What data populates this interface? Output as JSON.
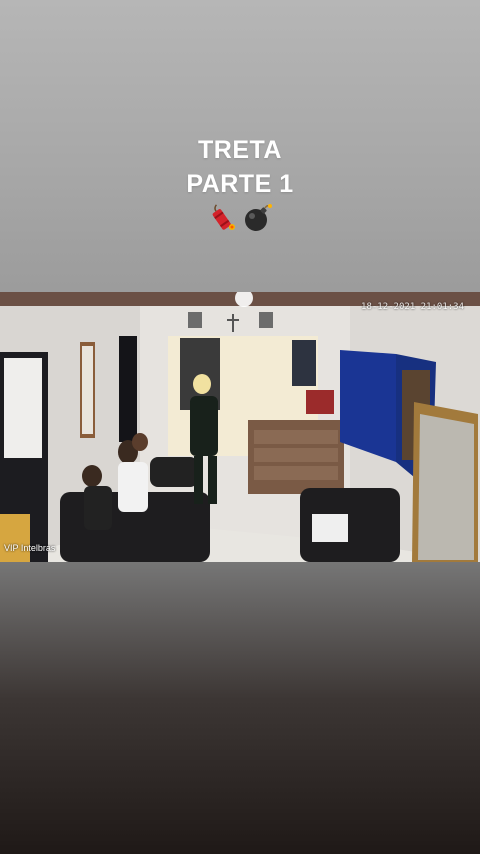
{
  "story": {
    "title_line1": "TRETA",
    "title_line2": "PARTE 1",
    "emojis": [
      "firecracker-icon",
      "bomb-icon"
    ]
  },
  "camera": {
    "timestamp": "18-12-2021 21:01:34",
    "watermark": "VIP Intelbras"
  }
}
